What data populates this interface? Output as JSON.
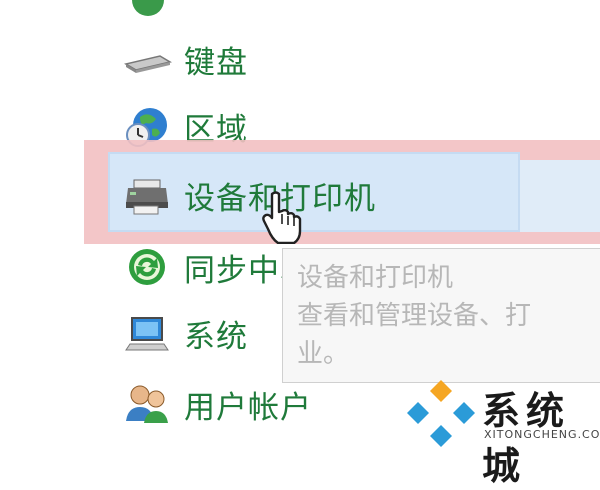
{
  "control_panel": {
    "items": [
      {
        "label": "键盘",
        "icon": "keyboard-icon"
      },
      {
        "label": "区域",
        "icon": "globe-clock-icon"
      },
      {
        "label": "设备和打印机",
        "icon": "printer-icon"
      },
      {
        "label": "同步中心",
        "icon": "sync-icon"
      },
      {
        "label": "系统",
        "icon": "computer-icon"
      },
      {
        "label": "用户帐户",
        "icon": "users-icon"
      }
    ]
  },
  "tooltip": {
    "title": "设备和打印机",
    "line1": "查看和管理设备、打",
    "line2": "业。"
  },
  "watermark": {
    "text": "系统城",
    "subtext": "XITONGCHENG.COM"
  },
  "colors": {
    "label_green": "#1f7a3a",
    "highlight_blue": "#d6e7f8",
    "highlight_red": "#f2c0c2"
  }
}
